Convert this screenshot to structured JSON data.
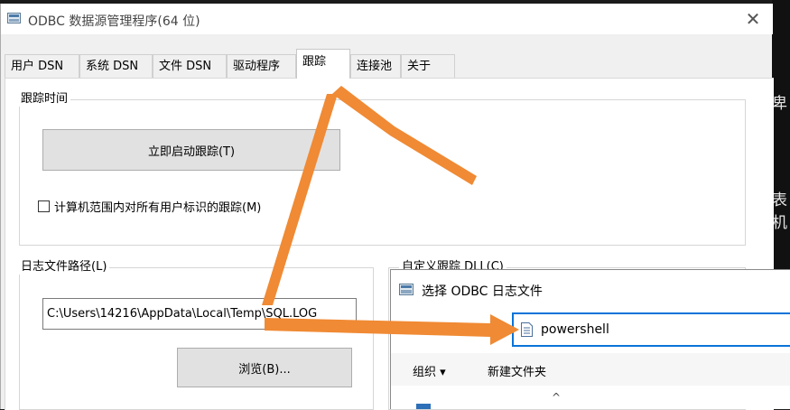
{
  "background": {
    "right_fragments": [
      "卑",
      "表机"
    ]
  },
  "window": {
    "title": "ODBC 数据源管理程序(64 位)",
    "close_glyph": "✕"
  },
  "tabs": [
    {
      "label": "用户 DSN"
    },
    {
      "label": "系统 DSN"
    },
    {
      "label": "文件 DSN"
    },
    {
      "label": "驱动程序"
    },
    {
      "label": "跟踪",
      "active": true
    },
    {
      "label": "连接池"
    },
    {
      "label": "关于"
    }
  ],
  "trace_time": {
    "group_label": "跟踪时间",
    "start_button": "立即启动跟踪(T)",
    "machine_wide_checkbox": "计算机范围内对所有用户标识的跟踪(M)",
    "checked": false
  },
  "log_path": {
    "group_label": "日志文件路径(L)",
    "value": "C:\\Users\\14216\\AppData\\Local\\Temp\\SQL.LOG",
    "browse_button": "浏览(B)..."
  },
  "custom_dll": {
    "group_label": "自定义跟踪 DLL(C)"
  },
  "file_dialog": {
    "title": "选择 ODBC 日志文件",
    "address_value": "powershell",
    "organize_label": "组织 ▾",
    "new_folder_label": "新建文件夹",
    "scroll_up_glyph": "^"
  },
  "annotation": {
    "arrow_color": "#f08a34"
  }
}
